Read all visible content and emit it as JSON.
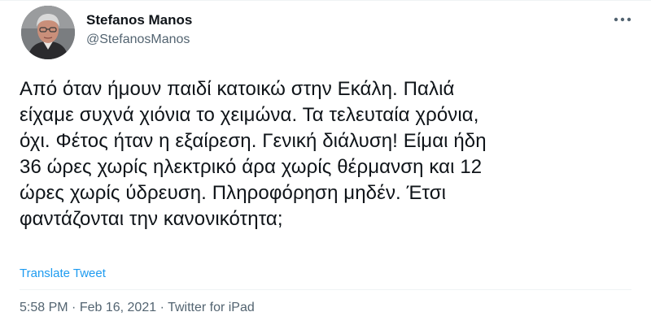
{
  "author": {
    "display_name": "Stefanos Manos",
    "handle": "@StefanosManos",
    "avatar_icon": "avatar"
  },
  "more_icon": "more-horizontal-icon",
  "tweet": {
    "lines": [
      "Από όταν ήμουν παιδί κατοικώ στην Εκάλη. Παλιά",
      "είχαμε συχνά χιόνια το χειμώνα. Τα τελευταία χρόνια,",
      "όχι. Φέτος ήταν η εξαίρεση. Γενική διάλυση! Είμαι ήδη",
      "36 ώρες χωρίς ηλεκτρικό άρα χωρίς θέρμανση και 12",
      "ώρες χωρίς ύδρευση. Πληροφόρηση μηδέν. Έτσι",
      "φαντάζονται την κανονικότητα;"
    ],
    "translate_label": "Translate Tweet"
  },
  "meta": {
    "time": "5:58 PM",
    "separator": "·",
    "date": "Feb 16, 2021",
    "source": "Twitter for iPad"
  },
  "colors": {
    "link": "#1d9bf0",
    "secondary_text": "#536471",
    "primary_text": "#0f1419"
  }
}
